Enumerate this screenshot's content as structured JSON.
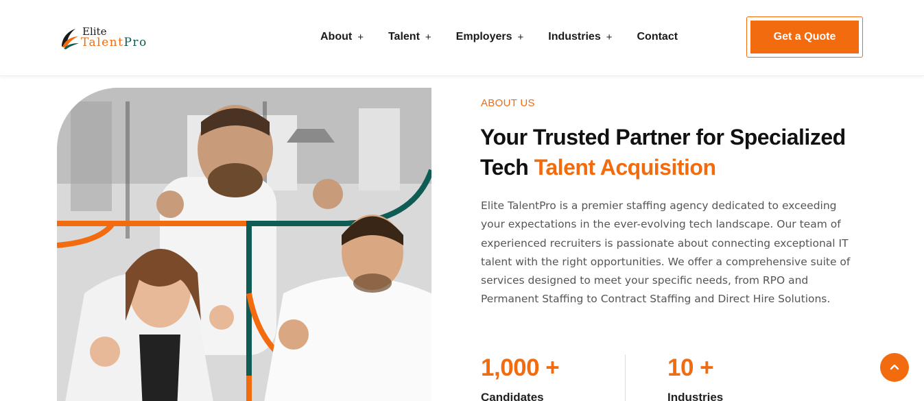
{
  "header": {
    "logo": {
      "line1": "Elite",
      "line2_a": "Talent",
      "line2_b": "Pro"
    },
    "nav": [
      {
        "label": "About",
        "expander": "+"
      },
      {
        "label": "Talent",
        "expander": "+"
      },
      {
        "label": "Employers",
        "expander": "+"
      },
      {
        "label": "Industries",
        "expander": "+"
      },
      {
        "label": "Contact",
        "expander": ""
      }
    ],
    "cta": "Get a Quote"
  },
  "about": {
    "label": "ABOUT US",
    "headline_a": "Your Trusted Partner for Specialized Tech ",
    "headline_accent": "Talent Acquisition",
    "description": "Elite TalentPro is a premier staffing agency dedicated to exceeding your expectations in the ever-evolving tech landscape. Our team of experienced recruiters is passionate about connecting exceptional IT talent with the right opportunities. We offer a comprehensive suite of services designed to meet your specific needs, from RPO and Permanent Staffing to Contract Staffing and Direct Hire Solutions.",
    "stats": [
      {
        "value": "1,000 +",
        "label": "Candidates"
      },
      {
        "value": "10 +",
        "label": "Industries"
      }
    ]
  },
  "colors": {
    "accent": "#f26b0f",
    "teal": "#0f5c55",
    "text": "#111111",
    "muted": "#555555"
  },
  "icons": {
    "scroll_top": "chevron-up-icon",
    "expander": "plus-icon"
  }
}
